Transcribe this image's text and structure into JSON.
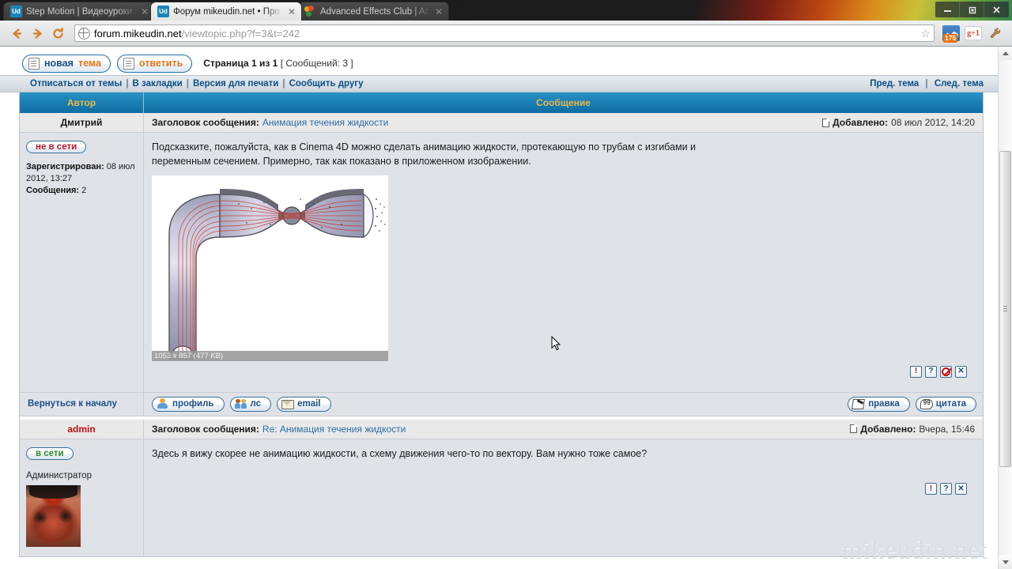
{
  "window": {
    "minimize_label": "–",
    "restore_label": "❐",
    "close_label": "✕"
  },
  "tabs": [
    {
      "title": "Step Motion | Видеоуроки",
      "favicon": "ud-icon",
      "active": false,
      "close_label": "✕"
    },
    {
      "title": "Форум mikeudin.net • Про",
      "favicon": "ud-icon",
      "active": true,
      "close_label": "✕"
    },
    {
      "title": "Advanced Effects Club | Ac",
      "favicon": "aec-icon",
      "active": false,
      "close_label": "✕"
    }
  ],
  "toolbar": {
    "back_label": "←",
    "forward_label": "→",
    "reload_label": "⟳",
    "url_host": "forum.mikeudin.net",
    "url_path": "/viewtopic.php?f=3&t=242",
    "bookmark_label": "☆",
    "extension_badge": "175",
    "gplus_label": "g+1",
    "menu_label": "🔧"
  },
  "forum": {
    "new_topic_word1": "новая",
    "new_topic_word2": "тема",
    "reply_word1": "",
    "reply_word2": "ответить",
    "page_label": "Страница 1 из 1",
    "posts_count_label": "[ Сообщений: 3 ]",
    "nav_links": [
      "Отписаться от темы",
      "В закладки",
      "Версия для печати",
      "Сообщить другу"
    ],
    "nav_separator": "|",
    "prev_topic": "Пред. тема",
    "next_topic": "След. тема",
    "col_author": "Автор",
    "col_message": "Сообщение",
    "subject_label": "Заголовок сообщения:",
    "posted_label": "Добавлено:",
    "back_to_top": "Вернуться к началу",
    "watermark": "mikeudin.net"
  },
  "buttons": {
    "profile": "профиль",
    "pm": "лс",
    "email": "email",
    "edit": "правка",
    "quote": "цитата",
    "report_label": "!",
    "help_label": "?",
    "block_label": "",
    "delete_label": "✕"
  },
  "posts": [
    {
      "author": "Дмитрий",
      "author_is_admin": false,
      "status_badge": "не в сети",
      "status_state": "offline",
      "registered_label": "Зарегистрирован:",
      "registered_value": "08 июл 2012, 13:27",
      "posts_label": "Сообщения:",
      "posts_value": "2",
      "subject": "Анимация течения жидкости",
      "posted_value": "08 июл 2012, 14:20",
      "body": "Подсказките, пожалуйста, как в Cinema 4D можно сделать анимацию жидкости, протекающую по трубам с изгибами и переменным сечением. Примерно, так как показано в приложенном изображении.",
      "attachment_caption": "1053 x 857 (477 KB)"
    },
    {
      "author": "admin",
      "author_is_admin": true,
      "status_badge": "в сети",
      "status_state": "online",
      "rank": "Администратор",
      "subject": "Re: Анимация течения жидкости",
      "posted_value": "Вчера, 15:46",
      "body": "Здесь я вижу скорее не анимацию жидкости, а схему движения чего-то по вектору. Вам нужно тоже самое?"
    }
  ],
  "colors": {
    "header_blue": "#1b7fb4",
    "header_text": "#e9b949",
    "link_blue": "#0a4e86",
    "admin_red": "#c01212",
    "online_green": "#2f8a2f",
    "offline_red": "#c4182a",
    "accent_orange": "#e2761b"
  }
}
